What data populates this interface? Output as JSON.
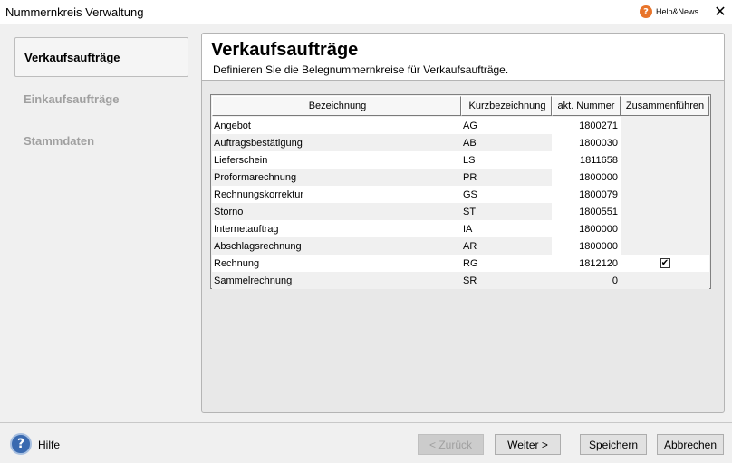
{
  "window": {
    "title": "Nummernkreis Verwaltung",
    "help_news": "Help&News",
    "help_icon": "?",
    "close": "✕"
  },
  "sidebar": {
    "items": [
      {
        "label": "Verkaufsaufträge",
        "active": true
      },
      {
        "label": "Einkaufsaufträge",
        "active": false
      },
      {
        "label": "Stammdaten",
        "active": false
      }
    ]
  },
  "main": {
    "title": "Verkaufsaufträge",
    "subtitle": "Definieren Sie die Belegnummernkreise für Verkaufsaufträge."
  },
  "table": {
    "columns": [
      "Bezeichnung",
      "Kurzbezeichnung",
      "akt. Nummer",
      "Zusammenführen"
    ],
    "rows": [
      {
        "name": "Angebot",
        "short": "AG",
        "number": "1800271",
        "merge": false
      },
      {
        "name": "Auftragsbestätigung",
        "short": "AB",
        "number": "1800030",
        "merge": false
      },
      {
        "name": "Lieferschein",
        "short": "LS",
        "number": "1811658",
        "merge": false
      },
      {
        "name": "Proformarechnung",
        "short": "PR",
        "number": "1800000",
        "merge": false
      },
      {
        "name": "Rechnungskorrektur",
        "short": "GS",
        "number": "1800079",
        "merge": false
      },
      {
        "name": "Storno",
        "short": "ST",
        "number": "1800551",
        "merge": false
      },
      {
        "name": "Internetauftrag",
        "short": "IA",
        "number": "1800000",
        "merge": false
      },
      {
        "name": "Abschlagsrechnung",
        "short": "AR",
        "number": "1800000",
        "merge": false
      },
      {
        "name": "Rechnung",
        "short": "RG",
        "number": "1812120",
        "merge": true,
        "check_glyph": "✔"
      },
      {
        "name": "Sammelrechnung",
        "short": "SR",
        "number": "0",
        "merge": false
      }
    ]
  },
  "footer": {
    "help_icon": "?",
    "help_label": "Hilfe",
    "back_label": "< Zurück",
    "next_label": "Weiter >",
    "save_label": "Speichern",
    "cancel_label": "Abbrechen"
  }
}
